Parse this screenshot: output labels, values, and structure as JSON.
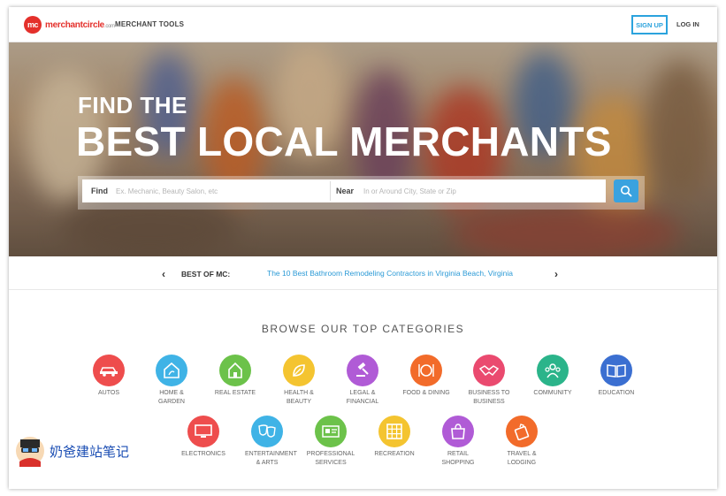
{
  "header": {
    "logo_badge": "mc",
    "logo_text": "merchantcircle",
    "logo_suffix": ".com",
    "merchant_tools": "MERCHANT TOOLS",
    "signup": "SIGN UP",
    "login": "LOG IN"
  },
  "hero": {
    "title_small": "FIND THE",
    "title_big": "BEST LOCAL MERCHANTS"
  },
  "search": {
    "find_label": "Find",
    "find_placeholder": "Ex. Mechanic, Beauty Salon, etc",
    "near_label": "Near",
    "near_placeholder": "In or Around City, State or Zip",
    "button_icon": "search-icon"
  },
  "best_of": {
    "label": "BEST OF MC:",
    "link": "The 10 Best Bathroom Remodeling Contractors in Virginia Beach, Virginia",
    "prev": "‹",
    "next": "›"
  },
  "categories": {
    "heading": "BROWSE OUR TOP CATEGORIES",
    "items": [
      {
        "label": "AUTOS",
        "color": "#ee4d4d",
        "icon": "car-icon"
      },
      {
        "label": "HOME & GARDEN",
        "color": "#3fb3e6",
        "icon": "house-icon"
      },
      {
        "label": "REAL ESTATE",
        "color": "#6cc24a",
        "icon": "building-icon"
      },
      {
        "label": "HEALTH & BEAUTY",
        "color": "#f4c430",
        "icon": "leaf-icon"
      },
      {
        "label": "LEGAL & FINANCIAL",
        "color": "#b05bd6",
        "icon": "gavel-icon"
      },
      {
        "label": "FOOD & DINING",
        "color": "#f26b2a",
        "icon": "plate-icon"
      },
      {
        "label": "BUSINESS TO BUSINESS",
        "color": "#ea4a6f",
        "icon": "handshake-icon"
      },
      {
        "label": "COMMUNITY",
        "color": "#2bb48a",
        "icon": "people-icon"
      },
      {
        "label": "EDUCATION",
        "color": "#3b6fd1",
        "icon": "book-icon"
      },
      {
        "label": "ELECTRONICS",
        "color": "#ee4d4d",
        "icon": "computer-icon"
      },
      {
        "label": "ENTERTAINMENT & ARTS",
        "color": "#3fb3e6",
        "icon": "masks-icon"
      },
      {
        "label": "PROFESSIONAL SERVICES",
        "color": "#6cc24a",
        "icon": "id-card-icon"
      },
      {
        "label": "RECREATION",
        "color": "#f4c430",
        "icon": "grid-icon"
      },
      {
        "label": "RETAIL SHOPPING",
        "color": "#b05bd6",
        "icon": "shopping-bag-icon"
      },
      {
        "label": "TRAVEL & LODGING",
        "color": "#f26b2a",
        "icon": "luggage-icon"
      }
    ]
  },
  "watermark": {
    "text": "奶爸建站笔记"
  }
}
